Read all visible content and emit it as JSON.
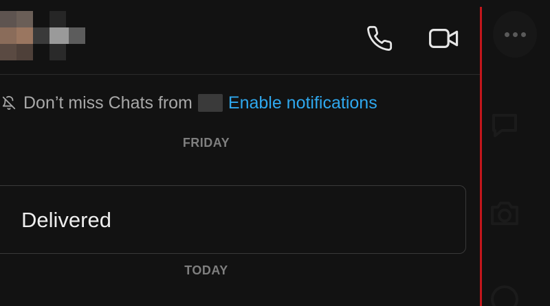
{
  "header": {
    "contact_avatar_icon": "pixelated-avatar",
    "call_icon": "phone-icon",
    "video_icon": "video-camera-icon"
  },
  "notification_banner": {
    "icon": "bell-off-icon",
    "text": "Don’t miss Chats from",
    "link_label": "Enable notifications"
  },
  "messages": {
    "day_friday": "FRIDAY",
    "status": "Delivered",
    "day_today": "TODAY"
  },
  "side_rail": {
    "more_icon": "more-horizontal-icon",
    "chat_icon": "chat-icon",
    "camera_icon": "camera-icon"
  },
  "colors": {
    "background": "#121212",
    "link": "#2fa8ee",
    "split_line": "#c4161c",
    "muted_text": "#a8a8a8"
  }
}
